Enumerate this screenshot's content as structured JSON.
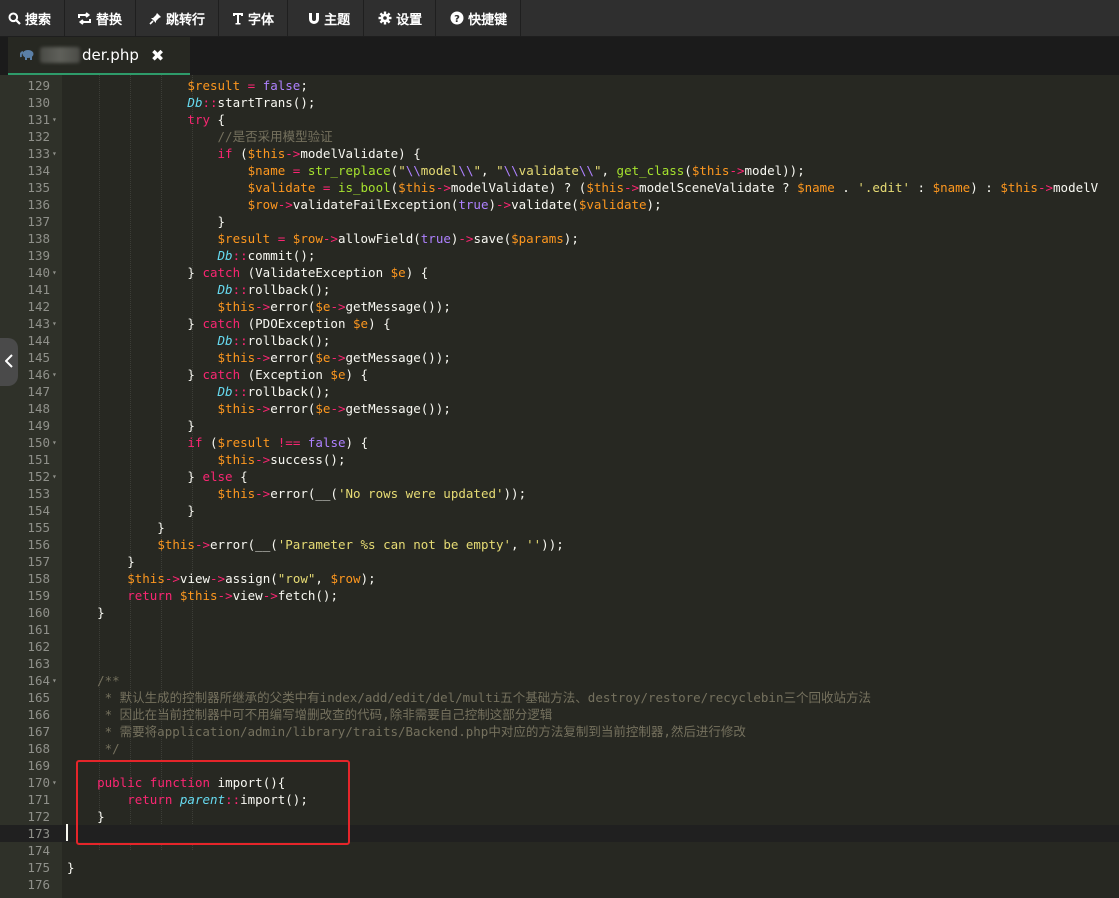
{
  "toolbar": {
    "items": [
      {
        "label": "搜索",
        "icon": "search-icon"
      },
      {
        "label": "替换",
        "icon": "replace-icon"
      },
      {
        "label": "跳转行",
        "icon": "pin-icon"
      },
      {
        "label": "字体",
        "icon": "text-icon"
      },
      {
        "label": "主题",
        "icon": "magnet-icon"
      },
      {
        "label": "设置",
        "icon": "gear-icon"
      },
      {
        "label": "快捷键",
        "icon": "help-icon"
      }
    ]
  },
  "tab": {
    "filename_visible": "der.php",
    "close_glyph": "✖",
    "icon": "php-elephant-icon"
  },
  "editor": {
    "cursor_line": 173,
    "lines": [
      {
        "n": 129,
        "html": "                <span class='v'>$result</span> <span class='k'>=</span> <span class='c'>false</span>;"
      },
      {
        "n": 130,
        "html": "                <span class='cl'>Db</span><span class='k'>::</span>startTrans();"
      },
      {
        "n": 131,
        "fold": true,
        "html": "                <span class='k'>try</span> {"
      },
      {
        "n": 132,
        "html": "                    <span class='cm'>//是否采用模型验证</span>"
      },
      {
        "n": 133,
        "fold": true,
        "html": "                    <span class='k'>if</span> (<span class='v'>$this</span><span class='k'>-&gt;</span>modelValidate) {"
      },
      {
        "n": 134,
        "html": "                        <span class='v'>$name</span> <span class='k'>=</span> <span class='sp'>str_replace</span>(<span class='s'>\"</span><span class='c'>\\\\</span><span class='s'>model</span><span class='c'>\\\\</span><span class='s'>\"</span>, <span class='s'>\"</span><span class='c'>\\\\</span><span class='s'>validate</span><span class='c'>\\\\</span><span class='s'>\"</span>, <span class='sp'>get_class</span>(<span class='v'>$this</span><span class='k'>-&gt;</span>model));"
      },
      {
        "n": 135,
        "html": "                        <span class='v'>$validate</span> <span class='k'>=</span> <span class='sp'>is_bool</span>(<span class='v'>$this</span><span class='k'>-&gt;</span>modelValidate) ? (<span class='v'>$this</span><span class='k'>-&gt;</span>modelSceneValidate ? <span class='v'>$name</span> . <span class='s'>'.edit'</span> : <span class='v'>$name</span>) : <span class='v'>$this</span><span class='k'>-&gt;</span>modelV"
      },
      {
        "n": 136,
        "html": "                        <span class='v'>$row</span><span class='k'>-&gt;</span>validateFailException(<span class='c'>true</span>)<span class='k'>-&gt;</span>validate(<span class='v'>$validate</span>);"
      },
      {
        "n": 137,
        "html": "                    }"
      },
      {
        "n": 138,
        "html": "                    <span class='v'>$result</span> <span class='k'>=</span> <span class='v'>$row</span><span class='k'>-&gt;</span>allowField(<span class='c'>true</span>)<span class='k'>-&gt;</span>save(<span class='v'>$params</span>);"
      },
      {
        "n": 139,
        "html": "                    <span class='cl'>Db</span><span class='k'>::</span>commit();"
      },
      {
        "n": 140,
        "fold": true,
        "html": "                } <span class='k'>catch</span> (ValidateException <span class='v'>$e</span>) {"
      },
      {
        "n": 141,
        "html": "                    <span class='cl'>Db</span><span class='k'>::</span>rollback();"
      },
      {
        "n": 142,
        "html": "                    <span class='v'>$this</span><span class='k'>-&gt;</span>error(<span class='v'>$e</span><span class='k'>-&gt;</span>getMessage());"
      },
      {
        "n": 143,
        "fold": true,
        "html": "                } <span class='k'>catch</span> (PDOException <span class='v'>$e</span>) {"
      },
      {
        "n": 144,
        "html": "                    <span class='cl'>Db</span><span class='k'>::</span>rollback();"
      },
      {
        "n": 145,
        "html": "                    <span class='v'>$this</span><span class='k'>-&gt;</span>error(<span class='v'>$e</span><span class='k'>-&gt;</span>getMessage());"
      },
      {
        "n": 146,
        "fold": true,
        "html": "                } <span class='k'>catch</span> (Exception <span class='v'>$e</span>) {"
      },
      {
        "n": 147,
        "html": "                    <span class='cl'>Db</span><span class='k'>::</span>rollback();"
      },
      {
        "n": 148,
        "html": "                    <span class='v'>$this</span><span class='k'>-&gt;</span>error(<span class='v'>$e</span><span class='k'>-&gt;</span>getMessage());"
      },
      {
        "n": 149,
        "html": "                }"
      },
      {
        "n": 150,
        "fold": true,
        "html": "                <span class='k'>if</span> (<span class='v'>$result</span> <span class='k'>!==</span> <span class='c'>false</span>) {"
      },
      {
        "n": 151,
        "html": "                    <span class='v'>$this</span><span class='k'>-&gt;</span>success();"
      },
      {
        "n": 152,
        "fold": true,
        "html": "                } <span class='k'>else</span> {"
      },
      {
        "n": 153,
        "html": "                    <span class='v'>$this</span><span class='k'>-&gt;</span>error(__(<span class='s'>'No rows were updated'</span>));"
      },
      {
        "n": 154,
        "html": "                }"
      },
      {
        "n": 155,
        "html": "            }"
      },
      {
        "n": 156,
        "html": "            <span class='v'>$this</span><span class='k'>-&gt;</span>error(__(<span class='s'>'Parameter %s can not be empty'</span>, <span class='s'>''</span>));"
      },
      {
        "n": 157,
        "html": "        }"
      },
      {
        "n": 158,
        "html": "        <span class='v'>$this</span><span class='k'>-&gt;</span>view<span class='k'>-&gt;</span>assign(<span class='s'>\"row\"</span>, <span class='v'>$row</span>);"
      },
      {
        "n": 159,
        "html": "        <span class='k'>return</span> <span class='v'>$this</span><span class='k'>-&gt;</span>view<span class='k'>-&gt;</span>fetch();"
      },
      {
        "n": 160,
        "html": "    }"
      },
      {
        "n": 161,
        "html": ""
      },
      {
        "n": 162,
        "html": ""
      },
      {
        "n": 163,
        "html": ""
      },
      {
        "n": 164,
        "fold": true,
        "html": "    <span class='cm'>/**</span>"
      },
      {
        "n": 165,
        "html": "    <span class='cm'> * 默认生成的控制器所继承的父类中有index/add/edit/del/multi五个基础方法、destroy/restore/recyclebin三个回收站方法</span>"
      },
      {
        "n": 166,
        "html": "    <span class='cm'> * 因此在当前控制器中可不用编写增删改查的代码,除非需要自己控制这部分逻辑</span>"
      },
      {
        "n": 167,
        "html": "    <span class='cm'> * 需要将application/admin/library/traits/Backend.php中对应的方法复制到当前控制器,然后进行修改</span>"
      },
      {
        "n": 168,
        "html": "    <span class='cm'> */</span>"
      },
      {
        "n": 169,
        "html": ""
      },
      {
        "n": 170,
        "fold": true,
        "html": "    <span class='k'>public</span> <span class='k'>function</span> import(){"
      },
      {
        "n": 171,
        "html": "        <span class='k'>return</span> <span class='cl'>parent</span><span class='k'>::</span>import();"
      },
      {
        "n": 172,
        "html": "    }"
      },
      {
        "n": 173,
        "active": true,
        "html": ""
      },
      {
        "n": 174,
        "html": ""
      },
      {
        "n": 175,
        "html": "}"
      },
      {
        "n": 176,
        "html": ""
      }
    ]
  },
  "colors": {
    "background": "#272822",
    "keyword": "#f92672",
    "variable": "#fd971f",
    "string": "#e6db74",
    "comment": "#75715e",
    "constant": "#ae81ff",
    "function": "#a6e22e",
    "class": "#66d9ef",
    "highlight_box": "#e5252a",
    "tab_underline": "#2e9b6a"
  }
}
